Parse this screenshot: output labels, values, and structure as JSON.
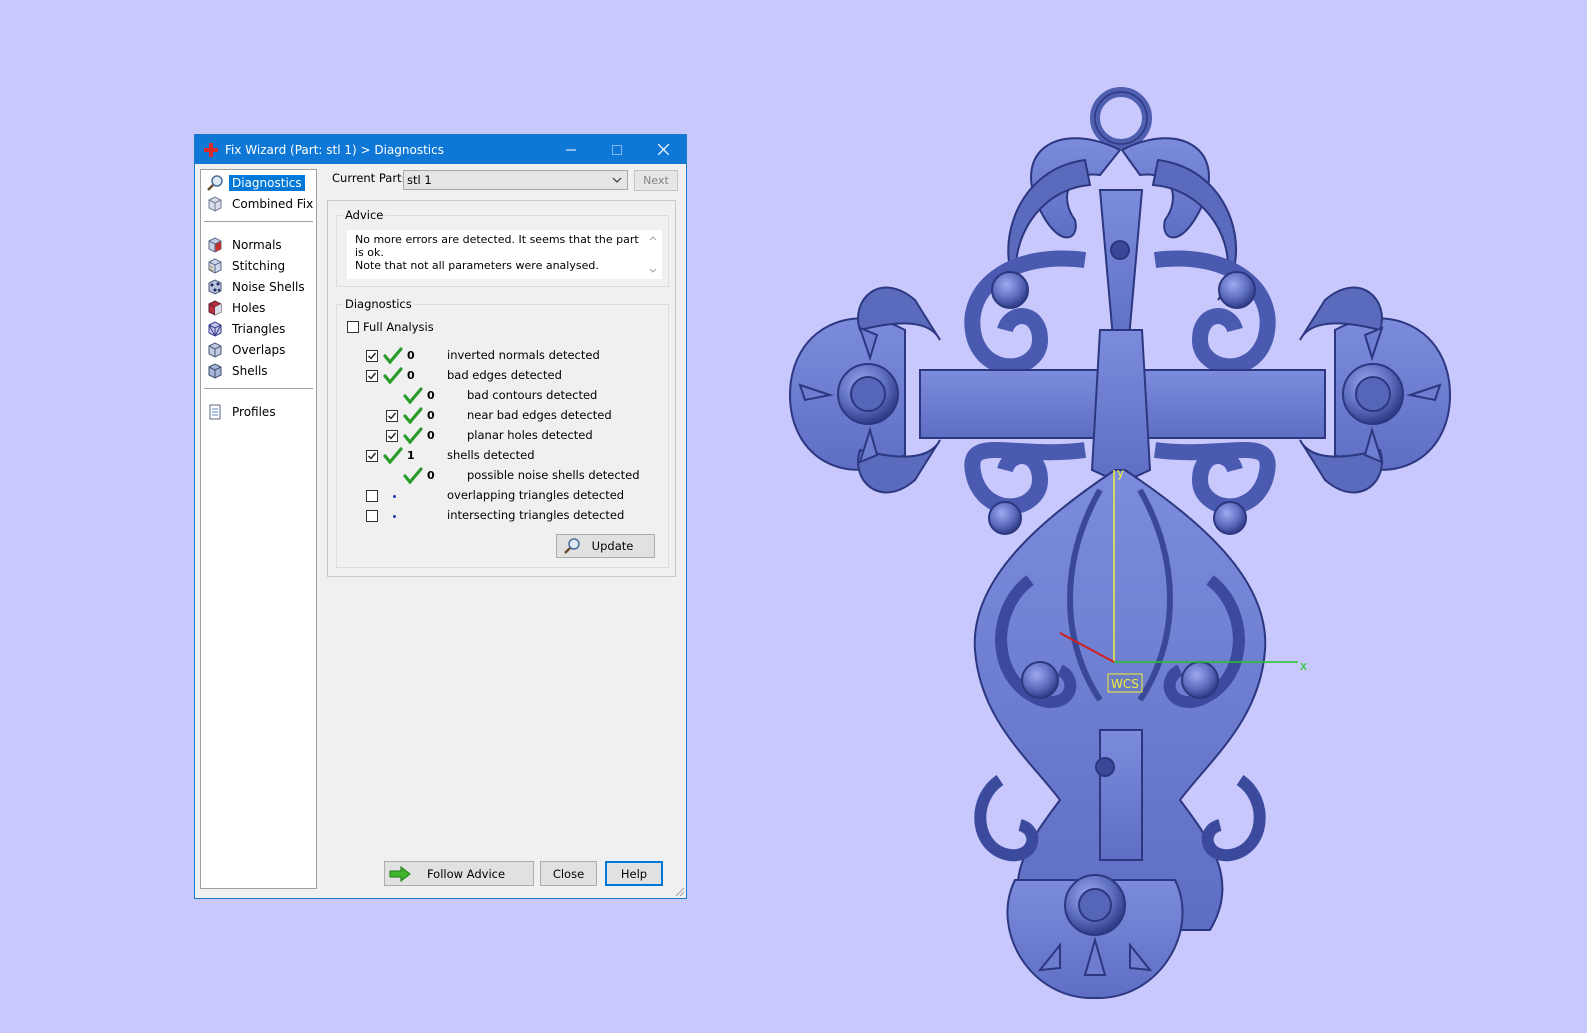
{
  "window": {
    "title": "Fix Wizard (Part: stl 1) > Diagnostics"
  },
  "nav": {
    "items": [
      {
        "label": "Diagnostics",
        "icon": "magnifier-icon"
      },
      {
        "label": "Combined Fix",
        "icon": "cube-icon"
      },
      {
        "label": "Normals",
        "icon": "normals-cube-icon"
      },
      {
        "label": "Stitching",
        "icon": "stitching-cube-icon"
      },
      {
        "label": "Noise Shells",
        "icon": "noise-shells-icon"
      },
      {
        "label": "Holes",
        "icon": "holes-cube-icon"
      },
      {
        "label": "Triangles",
        "icon": "triangles-cube-icon"
      },
      {
        "label": "Overlaps",
        "icon": "overlaps-cube-icon"
      },
      {
        "label": "Shells",
        "icon": "shells-cube-icon"
      },
      {
        "label": "Profiles",
        "icon": "document-icon"
      }
    ],
    "selected": "Diagnostics"
  },
  "current_part": {
    "label": "Current Part:",
    "value": "stl 1",
    "next_label": "Next"
  },
  "advice": {
    "title": "Advice",
    "line1": "No more errors are detected. It seems that the part is ok.",
    "line2": "Note that not all parameters were analysed."
  },
  "diagnostics": {
    "title": "Diagnostics",
    "full_analysis": "Full Analysis",
    "rows": [
      {
        "checked": true,
        "status": "ok",
        "count": "0",
        "label": "inverted normals detected",
        "indent": 0
      },
      {
        "checked": true,
        "status": "ok",
        "count": "0",
        "label": "bad edges detected",
        "indent": 0
      },
      {
        "checked": null,
        "status": "ok",
        "count": "0",
        "label": "bad contours detected",
        "indent": 1
      },
      {
        "checked": true,
        "status": "ok",
        "count": "0",
        "label": "near bad edges detected",
        "indent": 1
      },
      {
        "checked": true,
        "status": "ok",
        "count": "0",
        "label": "planar holes detected",
        "indent": 1
      },
      {
        "checked": true,
        "status": "ok",
        "count": "1",
        "label": "shells detected",
        "indent": 0
      },
      {
        "checked": null,
        "status": "ok",
        "count": "0",
        "label": "possible noise shells detected",
        "indent": 1
      },
      {
        "checked": false,
        "status": "pending",
        "count": "",
        "label": "overlapping triangles detected",
        "indent": 0
      },
      {
        "checked": false,
        "status": "pending",
        "count": "",
        "label": "intersecting triangles detected",
        "indent": 0
      }
    ],
    "update_label": "Update"
  },
  "footer": {
    "follow_advice": "Follow Advice",
    "close": "Close",
    "help": "Help"
  },
  "viewport": {
    "axis_x": "x",
    "axis_y": "y",
    "wcs_label": "WCS",
    "model_color": "#6a7cc4",
    "background_color": "#c8c8fc"
  }
}
